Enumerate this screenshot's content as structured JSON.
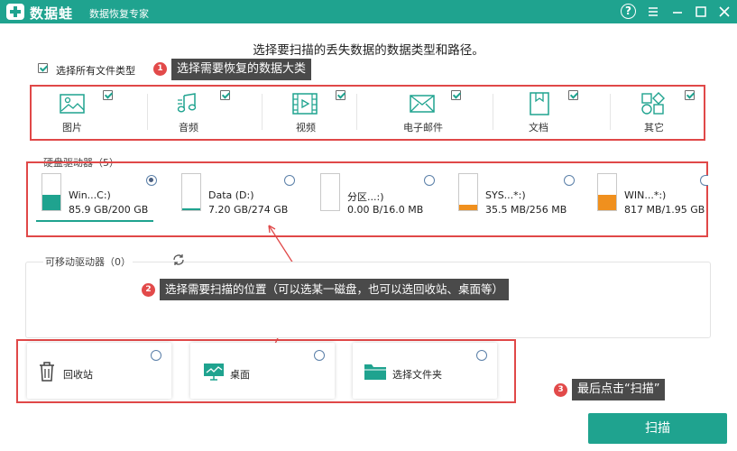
{
  "app": {
    "brand": "数据蛙",
    "subtitle": "数据恢复专家",
    "help": "?"
  },
  "headline": "选择要扫描的丢失数据的数据类型和路径。",
  "select_all": {
    "label": "选择所有文件类型",
    "checked": true
  },
  "file_types": [
    {
      "label": "图片",
      "icon": "image-icon",
      "checked": true
    },
    {
      "label": "音频",
      "icon": "music-icon",
      "checked": true
    },
    {
      "label": "视频",
      "icon": "video-icon",
      "checked": true
    },
    {
      "label": "电子邮件",
      "icon": "email-icon",
      "checked": true
    },
    {
      "label": "文档",
      "icon": "document-icon",
      "checked": true
    },
    {
      "label": "其它",
      "icon": "other-icon",
      "checked": true
    }
  ],
  "hard_drives": {
    "title": "硬盘驱动器（5）",
    "items": [
      {
        "name": "Win...C:)",
        "size": "85.9 GB/200 GB",
        "selected": true,
        "used_fraction": 0.43,
        "color": "#1fa38f"
      },
      {
        "name": "Data (D:)",
        "size": "7.20 GB/274 GB",
        "selected": false,
        "used_fraction": 0.03,
        "color": "#1fa38f"
      },
      {
        "name": "分区...:)",
        "size": "0.00  B/16.0 MB",
        "selected": false,
        "used_fraction": 0.0,
        "color": "#1fa38f"
      },
      {
        "name": "SYS...*:)",
        "size": "35.5 MB/256 MB",
        "selected": false,
        "used_fraction": 0.14,
        "color": "#f0901e"
      },
      {
        "name": "WIN...*:)",
        "size": "817 MB/1.95 GB",
        "selected": false,
        "used_fraction": 0.42,
        "color": "#f0901e"
      }
    ]
  },
  "removable": {
    "title": "可移动驱动器（0）"
  },
  "locations": [
    {
      "label": "回收站",
      "icon": "trash-icon",
      "selected": false
    },
    {
      "label": "桌面",
      "icon": "desktop-icon",
      "selected": false
    },
    {
      "label": "选择文件夹",
      "icon": "folder-icon",
      "selected": false
    }
  ],
  "annotations": [
    {
      "num": "1",
      "text": "选择需要恢复的数据大类"
    },
    {
      "num": "2",
      "text": "选择需要扫描的位置（可以选某一磁盘，也可以选回收站、桌面等）"
    },
    {
      "num": "3",
      "text": "最后点击“扫描”"
    }
  ],
  "scan_button": "扫描",
  "colors": {
    "accent": "#1fa38f",
    "annotation_red": "#e04848",
    "warning_orange": "#f0901e"
  }
}
